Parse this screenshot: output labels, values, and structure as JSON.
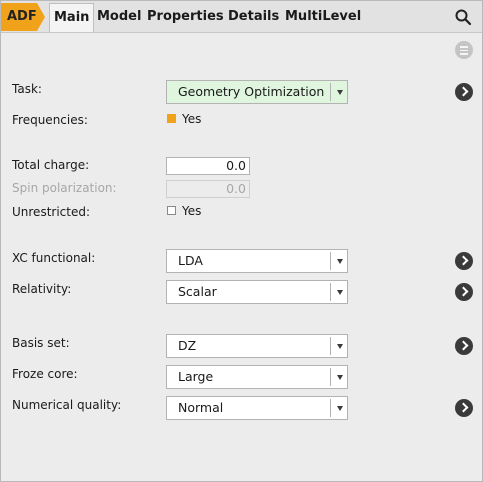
{
  "tabs": {
    "adf": "ADF",
    "items": [
      "Main",
      "Model",
      "Properties",
      "Details",
      "MultiLevel"
    ]
  },
  "main": {
    "task": {
      "label": "Task:",
      "value": "Geometry Optimization"
    },
    "frequencies": {
      "label": "Frequencies:",
      "check_label": "Yes",
      "checked": true
    },
    "total_charge": {
      "label": "Total charge:",
      "value": "0.0"
    },
    "spin_polarization": {
      "label": "Spin polarization:",
      "value": "0.0",
      "disabled": true
    },
    "unrestricted": {
      "label": "Unrestricted:",
      "check_label": "Yes",
      "checked": false
    },
    "xc_functional": {
      "label": "XC functional:",
      "value": "LDA"
    },
    "relativity": {
      "label": "Relativity:",
      "value": "Scalar"
    },
    "basis_set": {
      "label": "Basis set:",
      "value": "DZ"
    },
    "froze_core": {
      "label": "Froze core:",
      "value": "Large"
    },
    "numerical_quality": {
      "label": "Numerical quality:",
      "value": "Normal"
    }
  },
  "colors": {
    "accent": "#f0a21b",
    "task_field_bg": "#dff5dd",
    "panel_bg": "#ececec"
  },
  "icons": [
    "search-icon",
    "menu-icon",
    "details-arrow-icon"
  ]
}
